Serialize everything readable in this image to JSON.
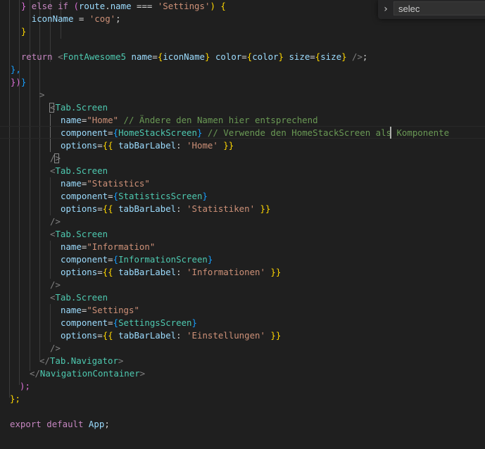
{
  "find_widget": {
    "toggle_icon": "chevron-right-icon",
    "query": "selec"
  },
  "code": {
    "l01": {
      "a": "    } ",
      "b": "else if",
      "c": " (",
      "d": "route",
      "e": ".",
      "f": "name",
      "g": " === ",
      "h": "'Settings'",
      "i": ") {"
    },
    "l02": {
      "a": "      ",
      "b": "iconName",
      "c": " = ",
      "d": "'cog'",
      "e": ";"
    },
    "l03": {
      "a": "    }"
    },
    "l05": {
      "a": "    ",
      "b": "return",
      "c": " <",
      "d": "FontAwesome5",
      "e": " ",
      "f": "name",
      "g": "=",
      "h": "{",
      "i": "iconName",
      "j": "}",
      "k": " ",
      "l": "color",
      "m": "=",
      "n": "{",
      "o": "color",
      "p": "}",
      "q": " ",
      "r": "size",
      "s": "=",
      "t": "{",
      "u": "size",
      "v": "}",
      "w": " />",
      "x": ";"
    },
    "l06": {
      "a": "  },"
    },
    "l07": {
      "a": "  })",
      "b": "}"
    },
    "l08": {
      "a": ">"
    },
    "l09": {
      "a": "<",
      "b": "Tab.Screen"
    },
    "l10": {
      "a": "name",
      "b": "=",
      "c": "\"Home\"",
      "d": " // Ändere den Namen hier entsprechend"
    },
    "l11": {
      "a": "component",
      "b": "=",
      "c": "{",
      "d": "HomeStackScreen",
      "e": "}",
      "f": " // Verwende den HomeStackScreen als Komponente"
    },
    "l12": {
      "a": "options",
      "b": "=",
      "c": "{{ ",
      "d": "tabBarLabel",
      "e": ": ",
      "f": "'Home'",
      "g": " }}"
    },
    "l13": {
      "a": "/",
      "b": ">"
    },
    "l14": {
      "a": "<",
      "b": "Tab.Screen"
    },
    "l15": {
      "a": "name",
      "b": "=",
      "c": "\"Statistics\""
    },
    "l16": {
      "a": "component",
      "b": "=",
      "c": "{",
      "d": "StatisticsScreen",
      "e": "}"
    },
    "l17": {
      "a": "options",
      "b": "=",
      "c": "{{ ",
      "d": "tabBarLabel",
      "e": ": ",
      "f": "'Statistiken'",
      "g": " }}"
    },
    "l18": {
      "a": "/>"
    },
    "l19": {
      "a": "<",
      "b": "Tab.Screen"
    },
    "l20": {
      "a": "name",
      "b": "=",
      "c": "\"Information\""
    },
    "l21": {
      "a": "component",
      "b": "=",
      "c": "{",
      "d": "InformationScreen",
      "e": "}"
    },
    "l22": {
      "a": "options",
      "b": "=",
      "c": "{{ ",
      "d": "tabBarLabel",
      "e": ": ",
      "f": "'Informationen'",
      "g": " }}"
    },
    "l23": {
      "a": "/>"
    },
    "l24": {
      "a": "<",
      "b": "Tab.Screen"
    },
    "l25": {
      "a": "name",
      "b": "=",
      "c": "\"Settings\""
    },
    "l26": {
      "a": "component",
      "b": "=",
      "c": "{",
      "d": "SettingsScreen",
      "e": "}"
    },
    "l27": {
      "a": "options",
      "b": "=",
      "c": "{{ ",
      "d": "tabBarLabel",
      "e": ": ",
      "f": "'Einstellungen'",
      "g": " }}"
    },
    "l28": {
      "a": "/>"
    },
    "l29": {
      "a": "</",
      "b": "Tab.Navigator",
      "c": ">"
    },
    "l30": {
      "a": "</",
      "b": "NavigationContainer",
      "c": ">"
    },
    "l31": {
      "a": ");"
    },
    "l32": {
      "a": "};"
    },
    "l34": {
      "a": "export",
      "b": " ",
      "c": "default",
      "d": " ",
      "e": "App",
      "f": ";"
    }
  },
  "colors": {
    "background": "#1f1f1f",
    "keyword": "#c586c0",
    "jsx_tag": "#4ec9b0",
    "attribute": "#9cdcfe",
    "string": "#ce9178",
    "comment": "#6a9955"
  }
}
